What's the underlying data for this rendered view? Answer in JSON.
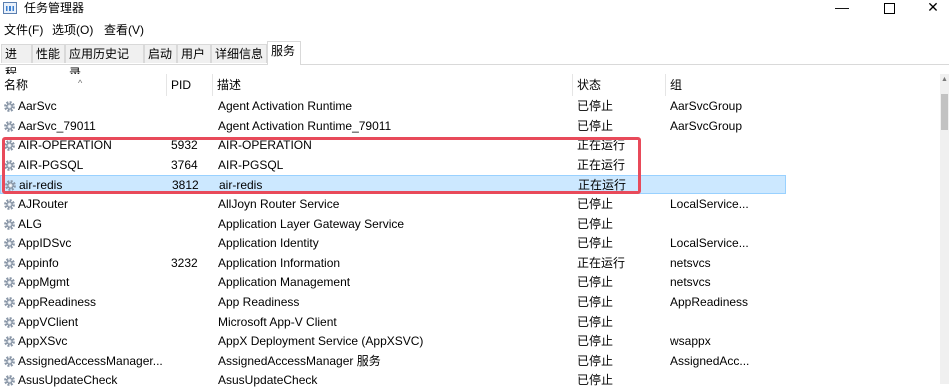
{
  "window": {
    "title": "任务管理器",
    "min_glyph": "—",
    "close_glyph": "✕"
  },
  "menu": [
    "文件(F)",
    "选项(O)",
    "查看(V)"
  ],
  "tabs": [
    {
      "label": "进程",
      "active": false
    },
    {
      "label": "性能",
      "active": false
    },
    {
      "label": "应用历史记录",
      "active": false
    },
    {
      "label": "启动",
      "active": false
    },
    {
      "label": "用户",
      "active": false
    },
    {
      "label": "详细信息",
      "active": false
    },
    {
      "label": "服务",
      "active": true
    }
  ],
  "columns": {
    "name": "名称",
    "pid": "PID",
    "desc": "描述",
    "status": "状态",
    "group": "组"
  },
  "sort_indicator": "^",
  "services": [
    {
      "name": "AarSvc",
      "pid": "",
      "desc": "Agent Activation Runtime",
      "status": "已停止",
      "group": "AarSvcGroup"
    },
    {
      "name": "AarSvc_79011",
      "pid": "",
      "desc": "Agent Activation Runtime_79011",
      "status": "已停止",
      "group": "AarSvcGroup"
    },
    {
      "name": "AIR-OPERATION",
      "pid": "5932",
      "desc": "AIR-OPERATION",
      "status": "正在运行",
      "group": ""
    },
    {
      "name": "AIR-PGSQL",
      "pid": "3764",
      "desc": "AIR-PGSQL",
      "status": "正在运行",
      "group": ""
    },
    {
      "name": "air-redis",
      "pid": "3812",
      "desc": "air-redis",
      "status": "正在运行",
      "group": "",
      "selected": true
    },
    {
      "name": "AJRouter",
      "pid": "",
      "desc": "AllJoyn Router Service",
      "status": "已停止",
      "group": "LocalService..."
    },
    {
      "name": "ALG",
      "pid": "",
      "desc": "Application Layer Gateway Service",
      "status": "已停止",
      "group": ""
    },
    {
      "name": "AppIDSvc",
      "pid": "",
      "desc": "Application Identity",
      "status": "已停止",
      "group": "LocalService..."
    },
    {
      "name": "Appinfo",
      "pid": "3232",
      "desc": "Application Information",
      "status": "正在运行",
      "group": "netsvcs"
    },
    {
      "name": "AppMgmt",
      "pid": "",
      "desc": "Application Management",
      "status": "已停止",
      "group": "netsvcs"
    },
    {
      "name": "AppReadiness",
      "pid": "",
      "desc": "App Readiness",
      "status": "已停止",
      "group": "AppReadiness"
    },
    {
      "name": "AppVClient",
      "pid": "",
      "desc": "Microsoft App-V Client",
      "status": "已停止",
      "group": ""
    },
    {
      "name": "AppXSvc",
      "pid": "",
      "desc": "AppX Deployment Service (AppXSVC)",
      "status": "已停止",
      "group": "wsappx"
    },
    {
      "name": "AssignedAccessManager...",
      "pid": "",
      "desc": "AssignedAccessManager 服务",
      "status": "已停止",
      "group": "AssignedAcc..."
    },
    {
      "name": "AsusUpdateCheck",
      "pid": "",
      "desc": "AsusUpdateCheck",
      "status": "已停止",
      "group": ""
    }
  ],
  "colors": {
    "selection_bg": "#cce8ff",
    "highlight_border": "#e84a5a"
  }
}
